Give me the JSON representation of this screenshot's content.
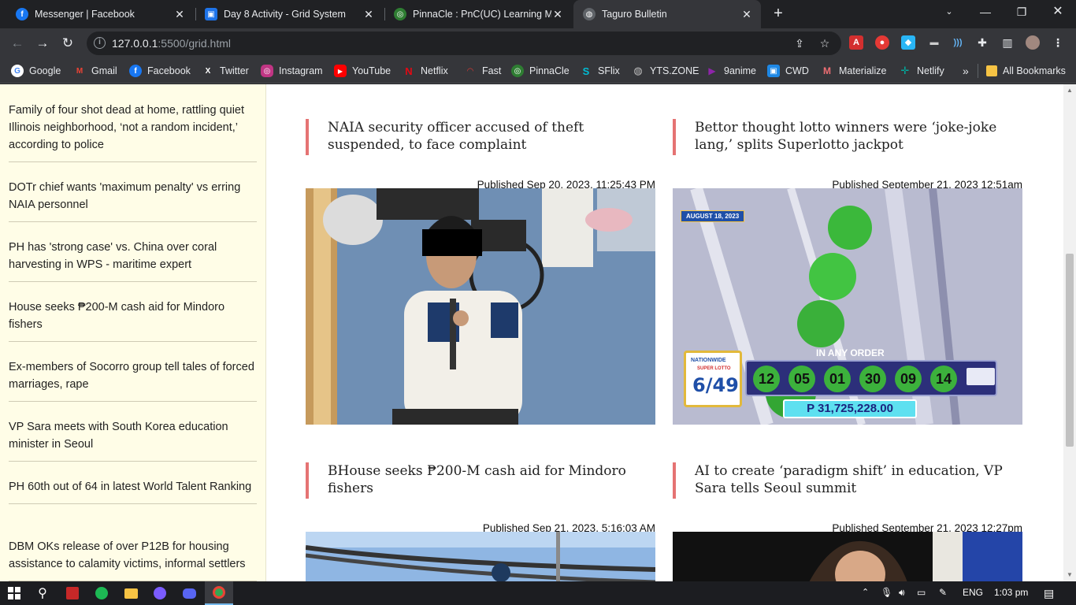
{
  "browser": {
    "tabs": [
      {
        "title": "Messenger | Facebook",
        "favicon": "facebook-icon",
        "color": "#1877f2"
      },
      {
        "title": "Day 8 Activity - Grid System",
        "favicon": "classroom-icon",
        "color": "#1e73e8"
      },
      {
        "title": "PinnaCle : PnC(UC) Learning Ma",
        "favicon": "pinnacle-icon",
        "color": "#2e7d32"
      },
      {
        "title": "Taguro Bulletin",
        "favicon": "globe-icon",
        "color": "#9aa0a6"
      }
    ],
    "url_host": "127.0.0.1",
    "url_rest": ":5500/grid.html",
    "bookmarks": [
      {
        "label": "Google",
        "icon": "google-icon",
        "color": "#4285f4"
      },
      {
        "label": "Gmail",
        "icon": "gmail-icon",
        "color": "#ea4335"
      },
      {
        "label": "Facebook",
        "icon": "facebook-icon",
        "color": "#1877f2"
      },
      {
        "label": "Twitter",
        "icon": "x-icon",
        "color": "#000000"
      },
      {
        "label": "Instagram",
        "icon": "instagram-icon",
        "color": "#c13584"
      },
      {
        "label": "YouTube",
        "icon": "youtube-icon",
        "color": "#ff0000"
      },
      {
        "label": "Netflix",
        "icon": "netflix-icon",
        "color": "#e50914"
      },
      {
        "label": "Fast",
        "icon": "fast-icon",
        "color": "#e53935"
      },
      {
        "label": "PinnaCle",
        "icon": "pinnacle-icon",
        "color": "#2e7d32"
      },
      {
        "label": "SFlix",
        "icon": "sflix-icon",
        "color": "#00bcd4"
      },
      {
        "label": "YTS.ZONE",
        "icon": "globe-icon",
        "color": "#9aa0a6"
      },
      {
        "label": "9anime",
        "icon": "play-icon",
        "color": "#8e24aa"
      },
      {
        "label": "CWD",
        "icon": "cwd-icon",
        "color": "#1e88e5"
      },
      {
        "label": "Materialize",
        "icon": "materialize-icon",
        "color": "#ee6e73"
      },
      {
        "label": "Netlify",
        "icon": "netlify-icon",
        "color": "#00ad9f"
      }
    ],
    "bookmarks_more": "»",
    "all_bookmarks": "All Bookmarks"
  },
  "sidebar": {
    "items": [
      "Family of four shot dead at home, rattling quiet Illinois neighborhood, ‘not a random incident,’ according to police",
      "DOTr chief wants 'maximum penalty' vs erring NAIA personnel",
      "PH has 'strong case' vs. China over coral harvesting in WPS - maritime expert",
      "House seeks ₱200-M cash aid for Mindoro fishers",
      "Ex-members of Socorro group tell tales of forced marriages, rape",
      "VP Sara meets with South Korea education minister in Seoul",
      "PH 60th out of 64 in latest World Talent Ranking",
      "DBM OKs release of over P12B for housing assistance to calamity victims, informal settlers"
    ]
  },
  "articles": [
    {
      "title": "NAIA security officer accused of theft suspended, to face complaint",
      "date": "Published Sep 20, 2023, 11:25:43 PM"
    },
    {
      "title": "Bettor thought lotto winners were ‘joke-joke lang,’ splits Superlotto jackpot",
      "date": "Published September 21, 2023 12:51am"
    },
    {
      "title": "BHouse seeks ₱200-M cash aid for Mindoro fishers",
      "date": "Published Sep 21, 2023, 5:16:03 AM"
    },
    {
      "title": "AI to create ‘paradigm shift’ in education, VP Sara tells Seoul summit",
      "date": "Published September 21, 2023 12:27pm"
    }
  ],
  "lotto": {
    "date_badge": "AUGUST 18, 2023",
    "in_any_order": "IN ANY ORDER",
    "numbers": [
      "12",
      "05",
      "01",
      "30",
      "09",
      "14"
    ],
    "jackpot": "P 31,725,228.00",
    "game": "6/49",
    "logo_small": "NATIONWIDE",
    "logo_sub": "SUPER LOTTO"
  },
  "taskbar": {
    "language": "ENG",
    "time": "1:03 pm"
  }
}
